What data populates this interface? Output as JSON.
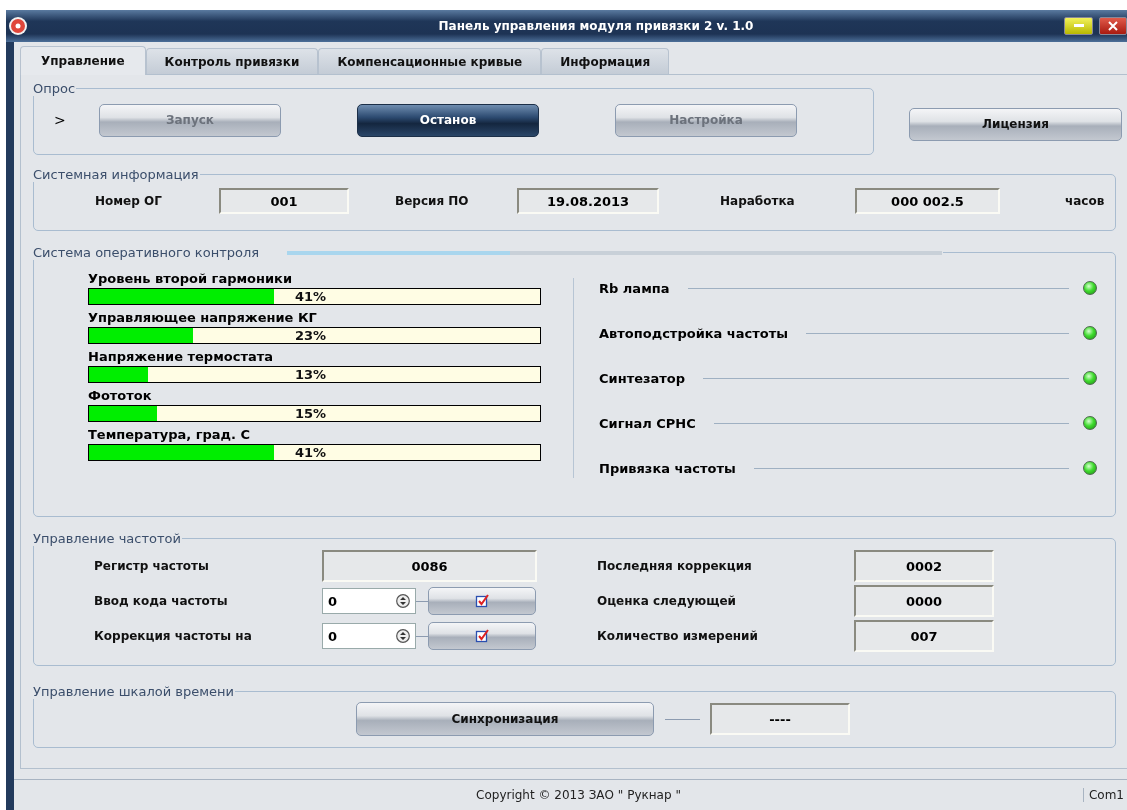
{
  "window": {
    "title": "Панель управления модуля привязки 2  v. 1.0"
  },
  "tabs": [
    {
      "label": "Управление",
      "selected": true
    },
    {
      "label": "Контроль привязки",
      "selected": false
    },
    {
      "label": "Компенсационные кривые",
      "selected": false
    },
    {
      "label": "Информация",
      "selected": false
    }
  ],
  "poll": {
    "title": "Опрос",
    "marker": ">",
    "buttons": [
      {
        "label": "Запуск",
        "disabled": true,
        "pressed": false
      },
      {
        "label": "Останов",
        "disabled": false,
        "pressed": true
      },
      {
        "label": "Настройка",
        "disabled": true,
        "pressed": false
      }
    ]
  },
  "license_button": {
    "label": "Лицензия"
  },
  "system_info": {
    "title": "Системная информация",
    "fields": [
      {
        "label": "Номер ОГ",
        "value": "001"
      },
      {
        "label": "Версия ПО",
        "value": "19.08.2013"
      },
      {
        "label": "Наработка",
        "value": "000 002.5",
        "unit": "часов"
      }
    ]
  },
  "monitoring": {
    "title": "Система оперативного контроля",
    "progress": {
      "level": 0.34
    },
    "meters": [
      {
        "label": "Уровень второй гармоники",
        "level": 0.41,
        "reading": "41%"
      },
      {
        "label": "Управляющее напряжение КГ",
        "level": 0.23,
        "reading": "23%"
      },
      {
        "label": "Напряжение термостата",
        "level": 0.13,
        "reading": "13%"
      },
      {
        "label": "Фототок",
        "level": 0.15,
        "reading": "15%"
      },
      {
        "label": "Температура, град. С",
        "level": 0.41,
        "reading": "41%"
      }
    ],
    "indicators": [
      {
        "label": "Rb лампа",
        "on": true
      },
      {
        "label": "Автоподстройка частоты",
        "on": true
      },
      {
        "label": "Синтезатор",
        "on": true
      },
      {
        "label": "Сигнал СРНС",
        "on": true
      },
      {
        "label": "Привязка частоты",
        "on": true
      }
    ]
  },
  "frequency": {
    "title": "Управление частотой",
    "rows": [
      {
        "kind": "display",
        "label": "Регистр частоты",
        "value": "0086"
      },
      {
        "kind": "spin",
        "label": "Ввод кода частоты",
        "value": "0"
      },
      {
        "kind": "spin",
        "label": "Коррекция частоты на",
        "value": "0"
      }
    ],
    "stats": [
      {
        "label": "Последняя коррекция",
        "value": "0002"
      },
      {
        "label": "Оценка следующей",
        "value": "0000"
      },
      {
        "label": "Количество измерений",
        "value": "007"
      }
    ]
  },
  "timescale": {
    "title": "Управление шкалой времени",
    "button": "Синхронизация",
    "value": "----"
  },
  "status_bar": {
    "text": "Copyright © 2013   ЗАО \" Рукнар \"",
    "port": "Com1"
  }
}
